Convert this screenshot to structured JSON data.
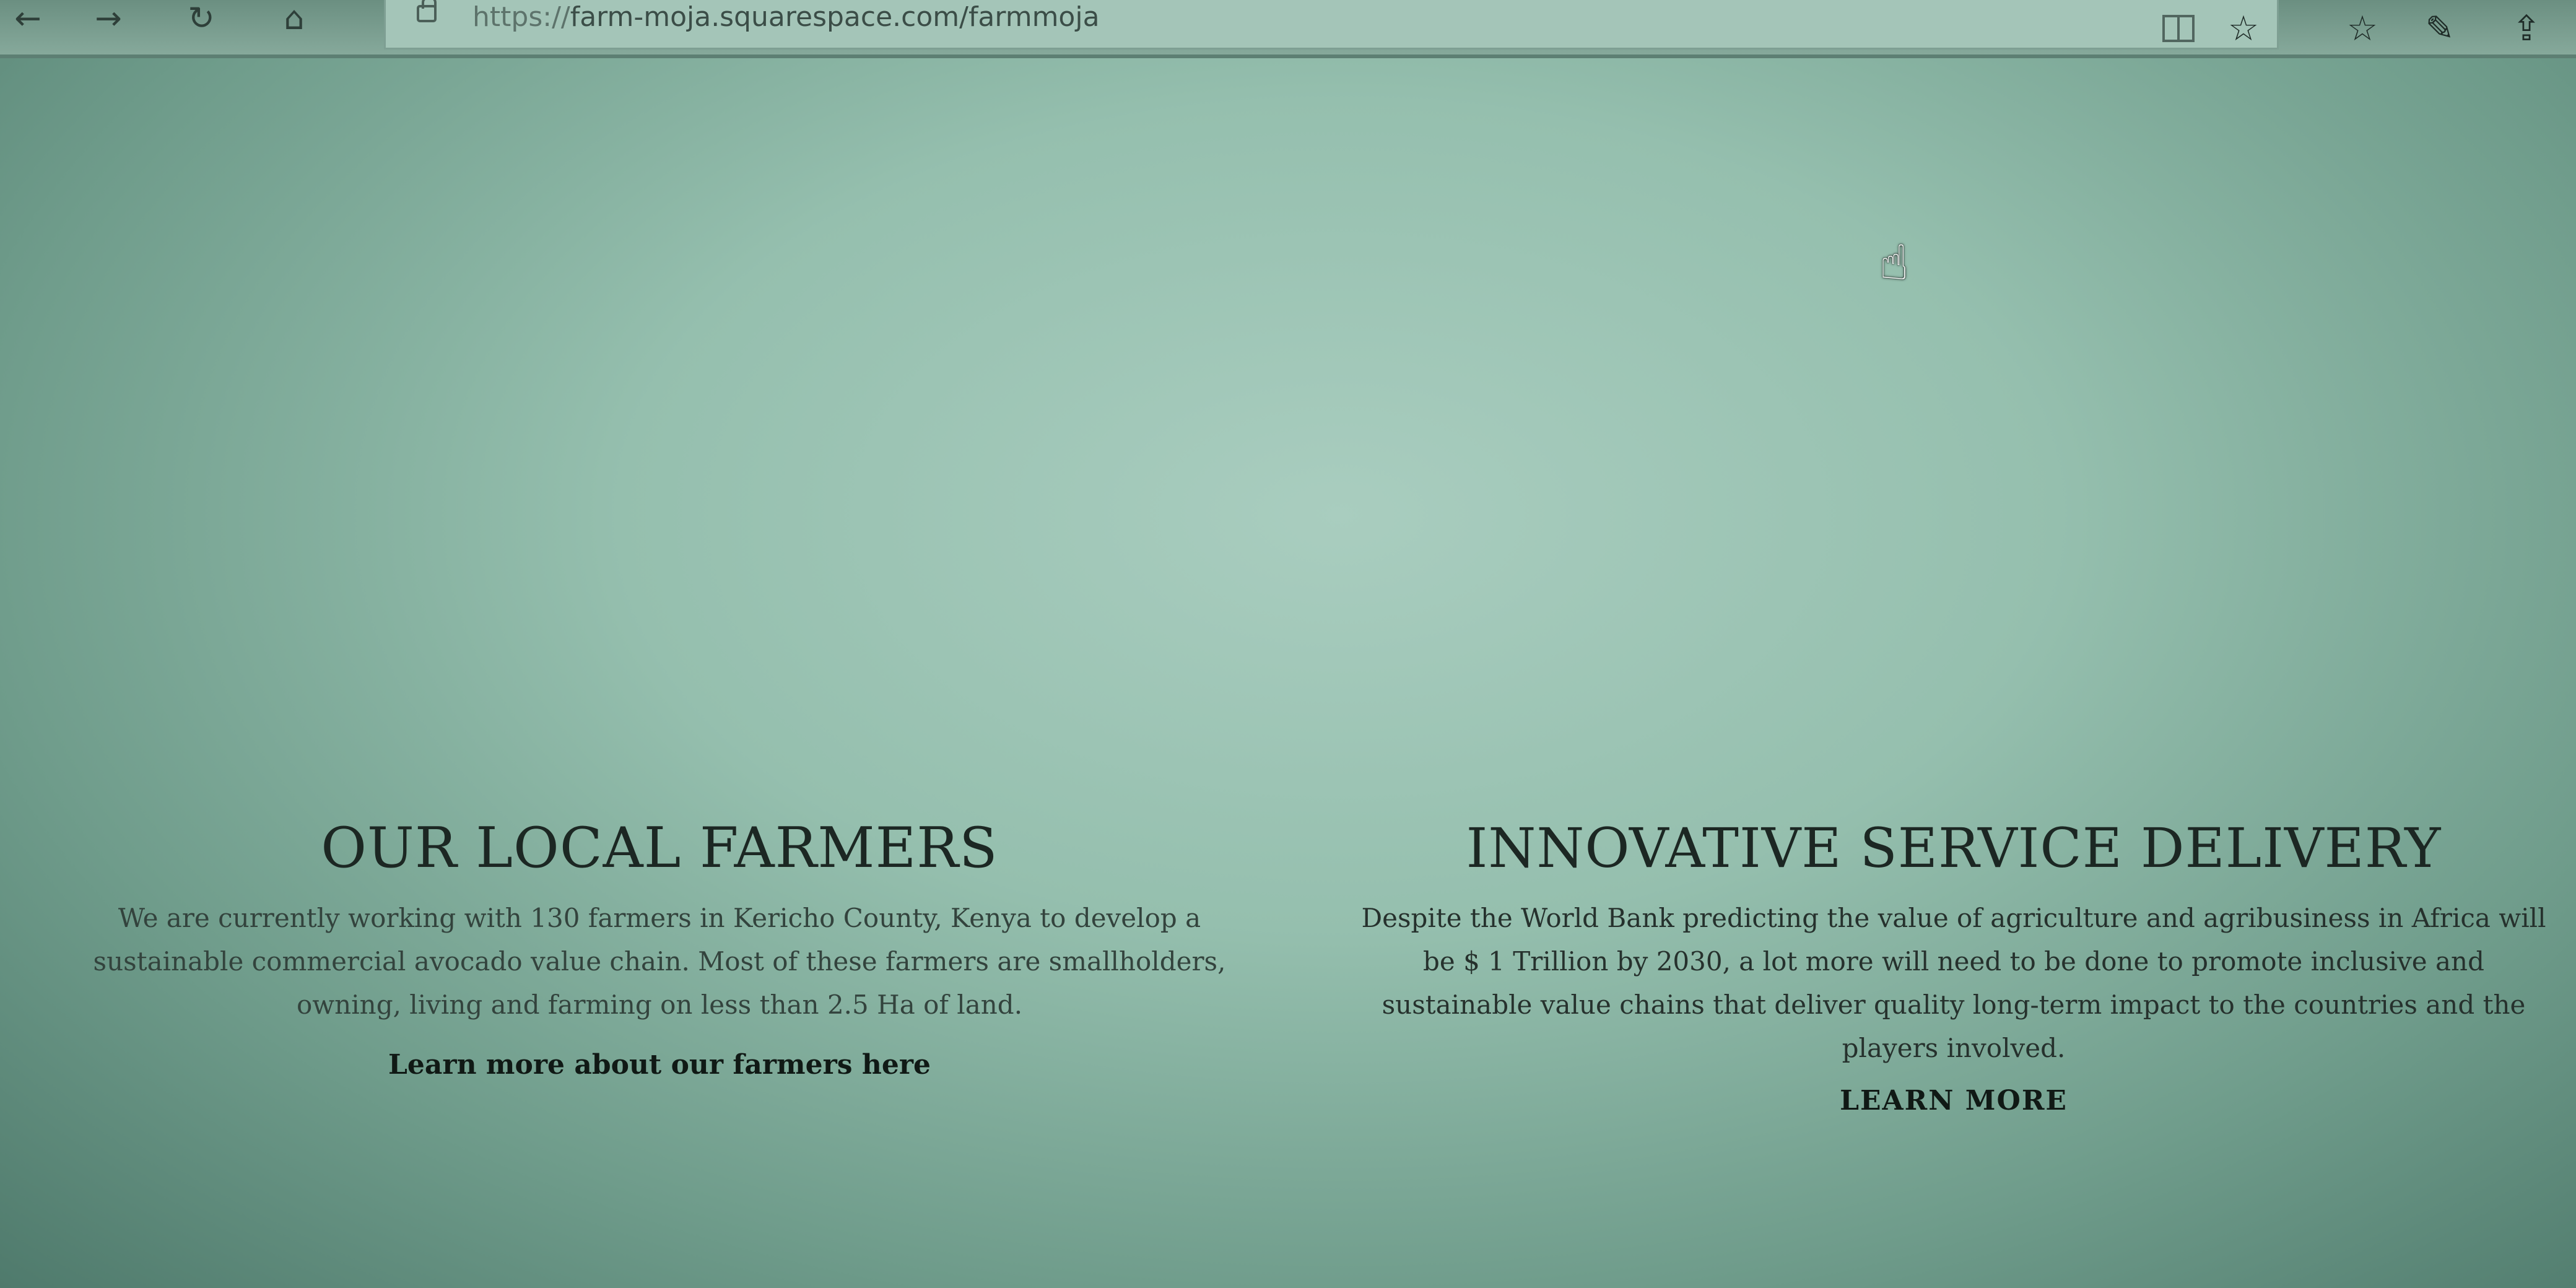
{
  "browser": {
    "url_scheme": "https://",
    "url_rest": "farm-moja.squarespace.com/farmmoja",
    "icons": {
      "back": "back-arrow-icon",
      "forward": "forward-arrow-icon",
      "refresh": "refresh-icon",
      "home": "home-icon",
      "lock": "lock-icon",
      "reading_view": "reading-view-icon",
      "favorite": "star-icon",
      "favorites_list": "favorites-list-icon",
      "notes": "pen-icon",
      "share": "share-icon"
    }
  },
  "sections": {
    "farmers": {
      "title": "OUR LOCAL FARMERS",
      "body": "We are currently working with 130 farmers in Kericho County, Kenya to develop a sustainable commercial avocado value chain. Most of these farmers are smallholders, owning, living and farming on less than 2.5 Ha of land.",
      "link": "Learn more about our farmers here"
    },
    "innovation": {
      "title": "INNOVATIVE SERVICE DELIVERY",
      "body": "Despite the World Bank predicting the value of agriculture and agribusiness in Africa will be $ 1 Trillion by 2030, a lot more will need to be done to promote inclusive and sustainable value chains that deliver quality long-term impact to the countries and the players involved.",
      "link": "LEARN MORE"
    }
  }
}
